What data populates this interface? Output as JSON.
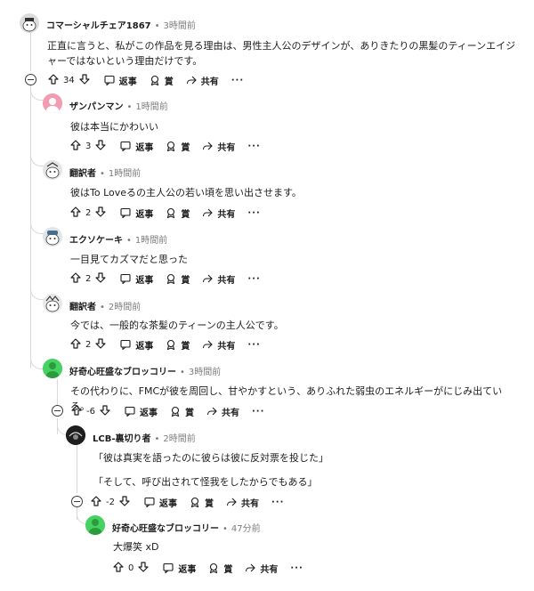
{
  "labels": {
    "reply": "返事",
    "award": "賞",
    "share": "共有",
    "more": "···"
  },
  "colors": {
    "broccoli_green": "#46d160",
    "thread_line": "#d7dadc",
    "muted_text": "#7c7c7c"
  },
  "comments": [
    {
      "user": "コマーシャルチェア1867",
      "time": "3時間前",
      "text": "正直に言うと、私がこの作品を見る理由は、男性主人公のデザインが、ありきたりの黒髪のティーンエイジャーではないという理由だけです。",
      "score": "34",
      "avatar": "mascot-avatar-1"
    },
    {
      "user": "ザンパンマン",
      "time": "1時間前",
      "text": "彼は本当にかわいい",
      "score": "3",
      "avatar": "pink-avatar"
    },
    {
      "user": "翻訳者",
      "time": "1時間前",
      "text": "彼はTo Loveるの主人公の若い頃を思い出させます。",
      "score": "2",
      "avatar": "mascot-avatar-2"
    },
    {
      "user": "エクソケーキ",
      "time": "1時間前",
      "text": "一目見てカズマだと思った",
      "score": "2",
      "avatar": "mascot-avatar-3"
    },
    {
      "user": "翻訳者",
      "time": "2時間前",
      "text": "今では、一般的な茶髪のティーンの主人公です。",
      "score": "2",
      "avatar": "mascot-avatar-4"
    },
    {
      "user": "好奇心旺盛なブロッコリー",
      "time": "3時間前",
      "text": "その代わりに、FMCが彼を周回し、甘やかすという、ありふれた弱虫のエネルギーがにじみ出ている。",
      "score": "-6",
      "avatar": "green-avatar"
    },
    {
      "user": "LCB-裏切り者",
      "time": "2時間前",
      "text": "「彼は真実を語ったのに彼らは彼に反対票を投じた」",
      "text2": "「そして、呼び出されて怪我をしたからでもある」",
      "score": "-2",
      "avatar": "dark-avatar"
    },
    {
      "user": "好奇心旺盛なブロッコリー",
      "time": "47分前",
      "text": "大爆笑 xD",
      "score": "0",
      "avatar": "green-avatar-2"
    }
  ]
}
